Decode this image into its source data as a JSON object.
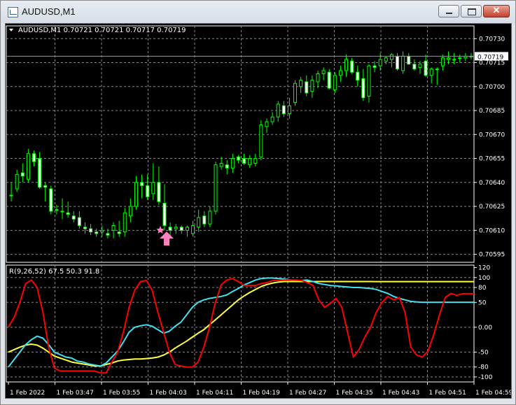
{
  "window": {
    "title": "AUDUSD,M1",
    "minimize_icon": "minimize-icon",
    "maximize_icon": "maximize-icon",
    "close_icon": "close-icon",
    "close_glyph": "✕"
  },
  "main_chart": {
    "header": "AUDUSD,M1  0.70721 0.70721 0.70717 0.70719",
    "current_price_label": "0.70719",
    "y_ticks": [
      "0.70730",
      "0.70715",
      "0.70700",
      "0.70685",
      "0.70670",
      "0.70655",
      "0.70640",
      "0.70625",
      "0.70610",
      "0.70595"
    ],
    "candle_color": "#00ff00",
    "signal_star_color": "#ff7fbf",
    "signal_arrow_color": "#ff7fbf"
  },
  "indicator": {
    "header": "R(9,26,52) 67.5 50.3 91.8",
    "y_ticks": [
      "120",
      "100",
      "80",
      "50",
      "0.00",
      "-50",
      "-80",
      "-100"
    ],
    "series_colors": {
      "fast": "#ff0000",
      "mid": "#40e0f0",
      "slow": "#ffff40"
    }
  },
  "x_ticks": [
    "1 Feb 2022",
    "1 Feb 03:47",
    "1 Feb 03:55",
    "1 Feb 04:03",
    "1 Feb 04:11",
    "1 Feb 04:19",
    "1 Feb 04:27",
    "1 Feb 04:35",
    "1 Feb 04:43",
    "1 Feb 04:51",
    "1 Feb 04:59"
  ],
  "chart_data": [
    {
      "type": "candlestick",
      "symbol": "AUDUSD",
      "timeframe": "M1",
      "ohlc": [
        [
          0.70632,
          0.7064,
          0.70628,
          0.70632
        ],
        [
          0.70636,
          0.70648,
          0.70634,
          0.70645
        ],
        [
          0.70646,
          0.70652,
          0.7064,
          0.70644
        ],
        [
          0.70642,
          0.70661,
          0.7064,
          0.70658
        ],
        [
          0.70658,
          0.7066,
          0.7065,
          0.70653
        ],
        [
          0.70655,
          0.70659,
          0.70636,
          0.70637
        ],
        [
          0.70638,
          0.7064,
          0.70628,
          0.70637
        ],
        [
          0.70636,
          0.70638,
          0.7062,
          0.70622
        ],
        [
          0.70623,
          0.70626,
          0.7062,
          0.70623
        ],
        [
          0.70622,
          0.7063,
          0.70617,
          0.70622
        ],
        [
          0.70621,
          0.70628,
          0.70618,
          0.7062
        ],
        [
          0.70619,
          0.70622,
          0.70615,
          0.70617
        ],
        [
          0.70618,
          0.70622,
          0.70611,
          0.70613
        ],
        [
          0.70612,
          0.70615,
          0.70608,
          0.70611
        ],
        [
          0.70611,
          0.70614,
          0.70607,
          0.70609
        ],
        [
          0.70609,
          0.70611,
          0.70606,
          0.70608
        ],
        [
          0.70609,
          0.70613,
          0.70606,
          0.7061
        ],
        [
          0.70608,
          0.70611,
          0.70605,
          0.70607
        ],
        [
          0.7061,
          0.70615,
          0.70605,
          0.70613
        ],
        [
          0.70609,
          0.70616,
          0.70606,
          0.70608
        ],
        [
          0.70609,
          0.70624,
          0.70606,
          0.70621
        ],
        [
          0.70619,
          0.7063,
          0.70615,
          0.70625
        ],
        [
          0.70625,
          0.70644,
          0.70623,
          0.7064
        ],
        [
          0.7064,
          0.70645,
          0.7063,
          0.70638
        ],
        [
          0.70638,
          0.70645,
          0.70629,
          0.70631
        ],
        [
          0.70633,
          0.70652,
          0.70629,
          0.7064
        ],
        [
          0.7064,
          0.7065,
          0.70626,
          0.70628
        ],
        [
          0.70627,
          0.70639,
          0.7061,
          0.70613
        ],
        [
          0.70612,
          0.70615,
          0.70607,
          0.7061
        ],
        [
          0.70611,
          0.70614,
          0.70608,
          0.70612
        ],
        [
          0.70612,
          0.70613,
          0.70608,
          0.7061
        ],
        [
          0.7061,
          0.70613,
          0.70606,
          0.70612
        ],
        [
          0.70608,
          0.70616,
          0.70606,
          0.70613
        ],
        [
          0.70612,
          0.70623,
          0.70609,
          0.70618
        ],
        [
          0.70619,
          0.70622,
          0.70612,
          0.70614
        ],
        [
          0.70614,
          0.70625,
          0.70612,
          0.70622
        ],
        [
          0.70622,
          0.70653,
          0.7062,
          0.70651
        ],
        [
          0.7065,
          0.70656,
          0.70648,
          0.70652
        ],
        [
          0.70651,
          0.70654,
          0.70645,
          0.70649
        ],
        [
          0.70649,
          0.70658,
          0.70646,
          0.70655
        ],
        [
          0.70656,
          0.70657,
          0.70652,
          0.70654
        ],
        [
          0.70655,
          0.70658,
          0.70651,
          0.70652
        ],
        [
          0.70651,
          0.70657,
          0.70649,
          0.70655
        ],
        [
          0.70652,
          0.70658,
          0.7065,
          0.70655
        ],
        [
          0.70656,
          0.70679,
          0.70654,
          0.70676
        ],
        [
          0.70675,
          0.7068,
          0.70671,
          0.70678
        ],
        [
          0.70678,
          0.70684,
          0.70676,
          0.70681
        ],
        [
          0.70681,
          0.70691,
          0.70678,
          0.70689
        ],
        [
          0.70688,
          0.70691,
          0.70681,
          0.70683
        ],
        [
          0.70683,
          0.70693,
          0.7068,
          0.70688
        ],
        [
          0.7069,
          0.70704,
          0.70688,
          0.70702
        ],
        [
          0.707,
          0.70706,
          0.70696,
          0.70704
        ],
        [
          0.70703,
          0.70707,
          0.70694,
          0.70696
        ],
        [
          0.70697,
          0.70707,
          0.70693,
          0.70704
        ],
        [
          0.70703,
          0.7071,
          0.70699,
          0.70708
        ],
        [
          0.70708,
          0.70712,
          0.70704,
          0.7071
        ],
        [
          0.70709,
          0.70711,
          0.70698,
          0.70699
        ],
        [
          0.70698,
          0.70709,
          0.70696,
          0.70707
        ],
        [
          0.70707,
          0.70713,
          0.70703,
          0.7071
        ],
        [
          0.7071,
          0.7072,
          0.70706,
          0.70717
        ],
        [
          0.70716,
          0.70718,
          0.70708,
          0.70709
        ],
        [
          0.70709,
          0.70713,
          0.707,
          0.70704
        ],
        [
          0.70705,
          0.70711,
          0.70691,
          0.70693
        ],
        [
          0.70694,
          0.70714,
          0.7069,
          0.70713
        ],
        [
          0.70713,
          0.70716,
          0.70709,
          0.70712
        ],
        [
          0.70713,
          0.70721,
          0.7071,
          0.70717
        ],
        [
          0.70716,
          0.70719,
          0.70714,
          0.70718
        ],
        [
          0.70717,
          0.70721,
          0.70712,
          0.7072
        ],
        [
          0.70719,
          0.70721,
          0.7071,
          0.70711
        ],
        [
          0.7071,
          0.70722,
          0.70708,
          0.70719
        ],
        [
          0.70719,
          0.70721,
          0.70714,
          0.70714
        ],
        [
          0.70714,
          0.70717,
          0.7071,
          0.70711
        ],
        [
          0.70712,
          0.70716,
          0.70708,
          0.70714
        ],
        [
          0.70716,
          0.7072,
          0.70706,
          0.70707
        ],
        [
          0.70707,
          0.70712,
          0.70702,
          0.70711
        ],
        [
          0.70711,
          0.70712,
          0.70701,
          0.70711
        ],
        [
          0.70713,
          0.7072,
          0.7071,
          0.70718
        ],
        [
          0.70717,
          0.70722,
          0.70714,
          0.70718
        ],
        [
          0.70717,
          0.70721,
          0.70714,
          0.70717
        ],
        [
          0.70718,
          0.7072,
          0.70715,
          0.70718
        ],
        [
          0.70718,
          0.70721,
          0.70716,
          0.70719
        ],
        [
          0.70719,
          0.70721,
          0.70717,
          0.70719
        ]
      ],
      "signal": {
        "bar": 27,
        "price": 0.70611,
        "type": "buy"
      },
      "current_price": 0.70719,
      "ylim": [
        0.7059,
        0.70738
      ],
      "grid": true
    },
    {
      "type": "line",
      "title": "R(9,26,52)",
      "ylim": [
        -110,
        125
      ],
      "x_count": 82,
      "series": [
        {
          "color": "#ff0000",
          "values": [
            0,
            20,
            50,
            88,
            95,
            80,
            30,
            -40,
            -82,
            -88,
            -88,
            -88,
            -88,
            -88,
            -88,
            -88,
            -92,
            -92,
            -70,
            -50,
            -10,
            40,
            75,
            92,
            94,
            75,
            30,
            -10,
            -50,
            -75,
            -78,
            -80,
            -80,
            -70,
            -40,
            0,
            50,
            85,
            95,
            98,
            92,
            84,
            84,
            84,
            88,
            90,
            94,
            94,
            95,
            95,
            95,
            94,
            90,
            84,
            55,
            40,
            48,
            58,
            40,
            -10,
            -60,
            -45,
            -20,
            0,
            30,
            50,
            62,
            55,
            60,
            30,
            -40,
            -56,
            -60,
            -48,
            -15,
            25,
            60,
            68,
            64,
            67.5,
            67.5,
            67.5
          ]
        },
        {
          "color": "#40e0f0",
          "values": [
            -80,
            -65,
            -50,
            -35,
            -25,
            -18,
            -22,
            -35,
            -50,
            -55,
            -60,
            -62,
            -68,
            -70,
            -74,
            -76,
            -78,
            -72,
            -60,
            -48,
            -30,
            -10,
            0,
            3,
            5,
            2,
            -5,
            -12,
            -8,
            2,
            10,
            25,
            40,
            50,
            55,
            58,
            60,
            62,
            65,
            72,
            78,
            85,
            90,
            95,
            98,
            99,
            99,
            98,
            97,
            95,
            94,
            94,
            95,
            92,
            88,
            86,
            84,
            83,
            82,
            81,
            80,
            80,
            79,
            78,
            76,
            72,
            68,
            62,
            58,
            55,
            52,
            51,
            50.3,
            50.3,
            50.3,
            50.3,
            50.3,
            50.3,
            50.3,
            50.3,
            50.3,
            50.3
          ]
        },
        {
          "color": "#ffff40",
          "values": [
            -50,
            -45,
            -40,
            -36,
            -34,
            -36,
            -42,
            -50,
            -58,
            -62,
            -66,
            -70,
            -72,
            -74,
            -76,
            -78,
            -78,
            -75,
            -72,
            -68,
            -66,
            -65,
            -64,
            -64,
            -63,
            -62,
            -60,
            -56,
            -50,
            -42,
            -35,
            -28,
            -20,
            -12,
            -5,
            5,
            15,
            25,
            35,
            45,
            55,
            63,
            70,
            76,
            82,
            86,
            89,
            91,
            92,
            92,
            92,
            92,
            92,
            92,
            92,
            92,
            92,
            92,
            92,
            92,
            92,
            92,
            92,
            92,
            91.8,
            91.8,
            91.8,
            91.8,
            91.8,
            91.8,
            91.8,
            91.8,
            91.8,
            91.8,
            91.8,
            91.8,
            91.8,
            91.8,
            91.8,
            91.8,
            91.8,
            91.8
          ]
        }
      ],
      "grid": true
    }
  ]
}
